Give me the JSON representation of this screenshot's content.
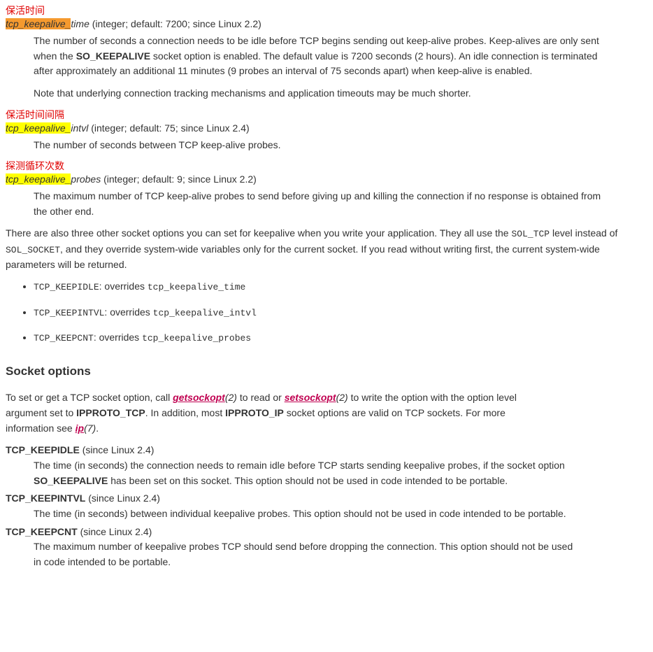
{
  "params": {
    "time": {
      "annotation": "保活时间",
      "prefix": "tcp_keepalive_",
      "suffix": "time",
      "meta": " (integer; default: 7200; since Linux 2.2)",
      "desc1": "The number of seconds a connection needs to be idle before TCP begins sending out keep-alive probes. Keep-alives are only sent when the ",
      "so_keepalive": "SO_KEEPALIVE",
      "desc1b": " socket option is enabled. The default value is 7200 seconds (2 hours). An idle connection is terminated after approximately an additional 11 minutes (9 probes an interval of 75 seconds apart) when keep-alive is enabled.",
      "desc2": "Note that underlying connection tracking mechanisms and application timeouts may be much shorter."
    },
    "intvl": {
      "annotation": "保活时间间隔",
      "prefix": "tcp_keepalive_",
      "suffix": "intvl",
      "meta": " (integer; default: 75; since Linux 2.4)",
      "desc": "The number of seconds between TCP keep-alive probes."
    },
    "probes": {
      "annotation": "探测循环次数",
      "prefix": "tcp_keepalive_",
      "suffix": "probes",
      "meta": " (integer; default: 9; since Linux 2.2)",
      "desc": "The maximum number of TCP keep-alive probes to send before giving up and killing the connection if no response is obtained from the other end."
    }
  },
  "intro": {
    "p1a": "There are also three other socket options you can set for keepalive when you write your application. They all use the ",
    "sol_tcp": "SOL_TCP",
    "p1b": " level instead of ",
    "sol_socket": "SOL_SOCKET",
    "p1c": ", and they override system-wide variables only for the current socket. If you read without writing first, the current system-wide parameters will be returned."
  },
  "overrides": [
    {
      "opt": "TCP_KEEPIDLE",
      "verb": ": overrides ",
      "target": "tcp_keepalive_time"
    },
    {
      "opt": "TCP_KEEPINTVL",
      "verb": ": overrides ",
      "target": "tcp_keepalive_intvl"
    },
    {
      "opt": "TCP_KEEPCNT",
      "verb": ": overrides ",
      "target": "tcp_keepalive_probes"
    }
  ],
  "section_title": "Socket options",
  "sockopt_intro": {
    "a": "To set or get a TCP socket option, call ",
    "getsockopt": "getsockopt",
    "getsockopt_ref": "(2)",
    "b": " to read or ",
    "setsockopt": "setsockopt",
    "setsockopt_ref": "(2)",
    "c": " to write the option with the option level argument set to ",
    "ipproto_tcp": "IPPROTO_TCP",
    "d": ". In addition, most ",
    "ipproto_ip": "IPPROTO_IP",
    "e": " socket options are valid on TCP sockets. For more information see ",
    "ip": "ip",
    "ip_ref": "(7)",
    "f": "."
  },
  "options": {
    "keepidle": {
      "name": "TCP_KEEPIDLE",
      "since": " (since Linux 2.4)",
      "desc_a": "The time (in seconds) the connection needs to remain idle before TCP starts sending keepalive probes, if the socket option ",
      "so_keepalive": "SO_KEEPALIVE",
      "desc_b": " has been set on this socket. This option should not be used in code intended to be portable."
    },
    "keepintvl": {
      "name": "TCP_KEEPINTVL",
      "since": " (since Linux 2.4)",
      "desc": "The time (in seconds) between individual keepalive probes. This option should not be used in code intended to be portable."
    },
    "keepcnt": {
      "name": "TCP_KEEPCNT",
      "since": " (since Linux 2.4)",
      "desc": "The maximum number of keepalive probes TCP should send before dropping the connection. This option should not be used in code intended to be portable."
    }
  }
}
